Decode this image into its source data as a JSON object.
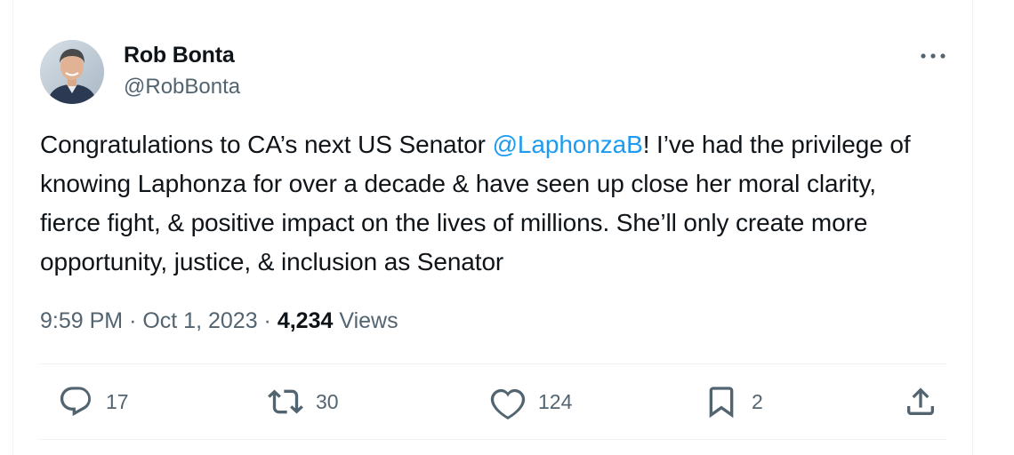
{
  "author": {
    "name": "Rob Bonta",
    "handle": "@RobBonta"
  },
  "tweet": {
    "text_before_mention": "Congratulations to CA’s next US Senator ",
    "mention": "@LaphonzaB",
    "text_after_mention": "!  I’ve had the privilege of knowing Laphonza for over a decade & have seen up close her moral clarity, fierce fight, & positive impact on the lives of millions. She’ll only create more opportunity, justice, & inclusion as Senator"
  },
  "meta": {
    "time": "9:59 PM",
    "separator": "·",
    "date": "Oct 1, 2023",
    "views_count": "4,234",
    "views_label": "Views"
  },
  "actions": {
    "replies": "17",
    "retweets": "30",
    "likes": "124",
    "bookmarks": "2"
  },
  "icons": {
    "more": "more-horizontal-icon",
    "reply": "reply-icon",
    "retweet": "retweet-icon",
    "like": "heart-icon",
    "bookmark": "bookmark-icon",
    "share": "share-icon"
  },
  "colors": {
    "text": "#0f1419",
    "secondary": "#536471",
    "link": "#1d9bf0",
    "divider": "#eff3f4"
  }
}
